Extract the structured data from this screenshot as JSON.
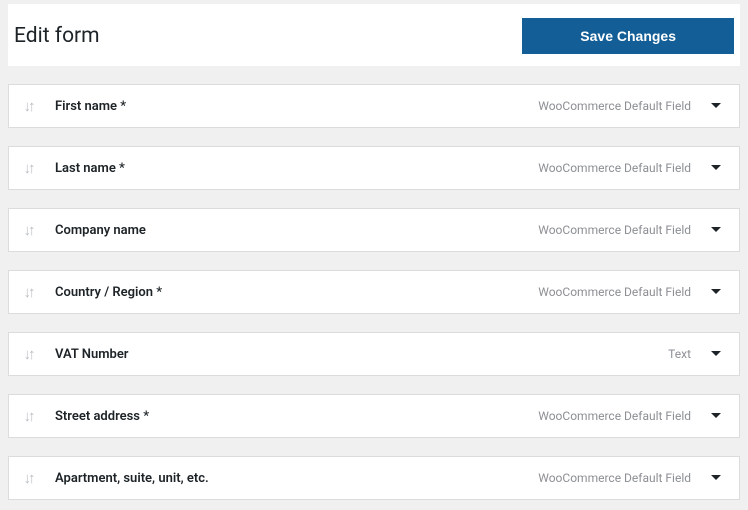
{
  "header": {
    "title": "Edit form",
    "save_label": "Save Changes"
  },
  "field_types": {
    "default": "WooCommerce Default Field",
    "text": "Text"
  },
  "fields": [
    {
      "label": "First name *",
      "type_key": "default"
    },
    {
      "label": "Last name *",
      "type_key": "default"
    },
    {
      "label": "Company name",
      "type_key": "default"
    },
    {
      "label": "Country / Region *",
      "type_key": "default"
    },
    {
      "label": "VAT Number",
      "type_key": "text"
    },
    {
      "label": "Street address *",
      "type_key": "default"
    },
    {
      "label": "Apartment, suite, unit, etc.",
      "type_key": "default"
    }
  ]
}
